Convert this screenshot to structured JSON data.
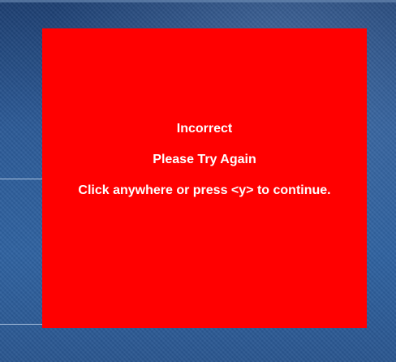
{
  "feedback": {
    "title": "Incorrect",
    "subtitle": "Please Try Again",
    "instruction": "Click anywhere or press <y> to continue."
  },
  "colors": {
    "feedback_background": "#ff0000",
    "feedback_text": "#ffffff",
    "backdrop": "#2a4f86"
  }
}
